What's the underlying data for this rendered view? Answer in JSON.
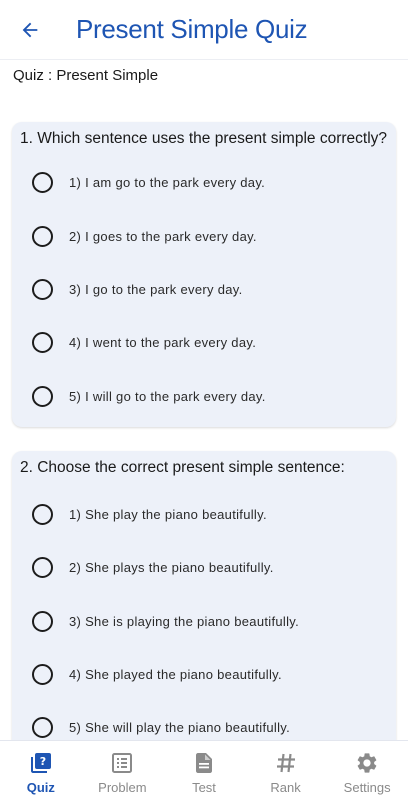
{
  "header": {
    "title": "Present Simple Quiz",
    "back_icon": "arrow-left-icon",
    "accent": "#1e55b3"
  },
  "quiz": {
    "subtitle": "Quiz : Present Simple",
    "questions": [
      {
        "text": "1. Which sentence uses the present simple correctly?",
        "options": [
          "1) I am go to the park every day.",
          "2) I goes to the park every day.",
          "3) I go to the park every day.",
          "4) I went to the park every day.",
          "5) I will go to the park every day."
        ]
      },
      {
        "text": "2. Choose the correct present simple sentence:",
        "options": [
          "1) She play the piano beautifully.",
          "2) She plays the piano beautifully.",
          "3) She is playing the piano beautifully.",
          "4) She played the piano beautifully.",
          "5) She will play the piano beautifully."
        ]
      }
    ]
  },
  "nav": {
    "items": [
      {
        "label": "Quiz",
        "icon": "quiz-icon",
        "active": true
      },
      {
        "label": "Problem",
        "icon": "list-icon",
        "active": false
      },
      {
        "label": "Test",
        "icon": "document-icon",
        "active": false
      },
      {
        "label": "Rank",
        "icon": "hash-icon",
        "active": false
      },
      {
        "label": "Settings",
        "icon": "gear-icon",
        "active": false
      }
    ]
  },
  "colors": {
    "card_background": "#edf1f9",
    "nav_inactive": "#8a8a8a",
    "nav_active": "#1e55b3"
  }
}
